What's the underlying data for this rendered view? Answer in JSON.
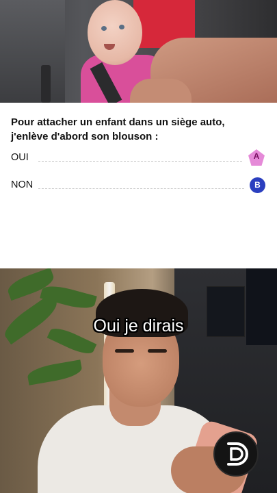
{
  "quiz": {
    "question_line1": "Pour attacher un enfant dans un siège auto,",
    "question_line2": "j'enlève d'abord son blouson :",
    "options": [
      {
        "label": "OUI",
        "badge": "A",
        "badge_color": "#e58ad8"
      },
      {
        "label": "NON",
        "badge": "B",
        "badge_color": "#2b3fbf"
      }
    ]
  },
  "video": {
    "caption": "Oui je dirais",
    "logo_icon": "channel-logo-icon"
  }
}
